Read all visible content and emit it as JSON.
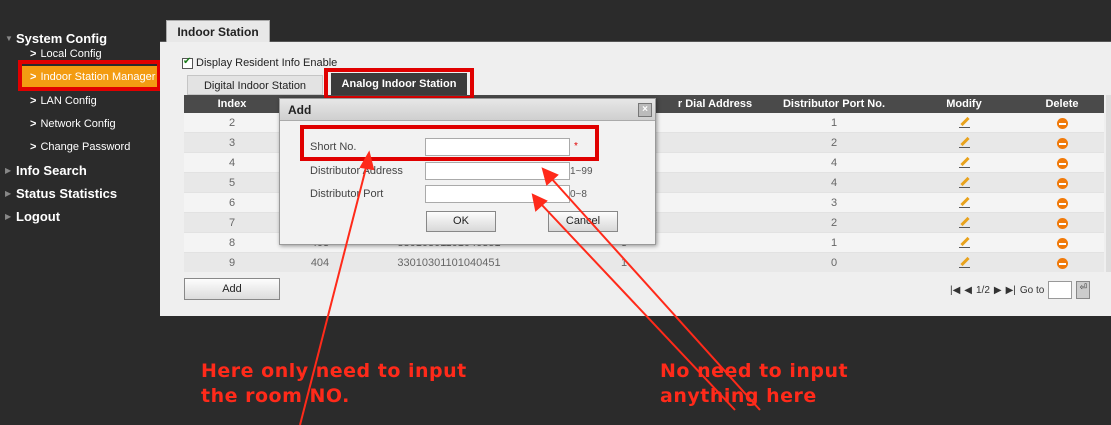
{
  "sidebar": {
    "sections": [
      {
        "label": "System Config"
      },
      {
        "label": "Info Search"
      },
      {
        "label": "Status Statistics"
      },
      {
        "label": "Logout"
      }
    ],
    "items": [
      {
        "label": "Local Config"
      },
      {
        "label": "Indoor Station Manager"
      },
      {
        "label": "LAN Config"
      },
      {
        "label": "Network Config"
      },
      {
        "label": "Change Password"
      }
    ]
  },
  "main": {
    "tab_label": "Indoor Station",
    "display_resident_label": "Display Resident Info Enable",
    "subtabs": [
      "Digital Indoor Station",
      "Analog Indoor Station"
    ],
    "table": {
      "headers": [
        "Index",
        "r Dial Address",
        "Distributor Port No.",
        "Modify",
        "Delete"
      ],
      "rows": [
        {
          "index": "2",
          "port": "1"
        },
        {
          "index": "3",
          "port": "2"
        },
        {
          "index": "4",
          "port": "4"
        },
        {
          "index": "5",
          "port": "4"
        },
        {
          "index": "6",
          "port": "3"
        },
        {
          "index": "7",
          "port": "2"
        },
        {
          "index": "8",
          "short": "403",
          "phone": "33010301101040351",
          "dial": "3",
          "port": "1"
        },
        {
          "index": "9",
          "short": "404",
          "phone": "33010301101040451",
          "dial": "1",
          "port": "0"
        }
      ]
    },
    "add_button": "Add",
    "pager": {
      "text": "1/2",
      "goto_label": "Go to"
    }
  },
  "dialog": {
    "title": "Add",
    "fields": [
      {
        "label": "Short No.",
        "hint": "*"
      },
      {
        "label": "Distributor Address",
        "hint": "1~99"
      },
      {
        "label": "Distributor Port",
        "hint": "0~8"
      }
    ],
    "ok": "OK",
    "cancel": "Cancel"
  },
  "annotations": {
    "left_line1": "Here only need to input",
    "left_line2": "the room NO.",
    "right_line1": "No need to input",
    "right_line2": "anything here"
  },
  "colors": {
    "accent": "#f39c12",
    "highlight_box": "#e00000",
    "annotation": "#ff2a1a"
  }
}
